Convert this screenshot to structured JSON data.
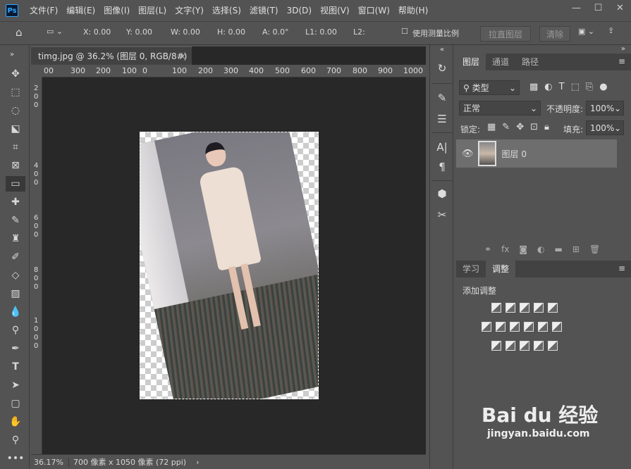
{
  "menubar": {
    "logo": "Ps",
    "items": [
      "文件(F)",
      "编辑(E)",
      "图像(I)",
      "图层(L)",
      "文字(Y)",
      "选择(S)",
      "滤镜(T)",
      "3D(D)",
      "视图(V)",
      "窗口(W)",
      "帮助(H)"
    ],
    "window_controls": [
      "minimize",
      "maximize",
      "close"
    ]
  },
  "options": {
    "x": "X: 0.00",
    "y": "Y: 0.00",
    "w": "W:  0.00",
    "h": "H:  0.00",
    "a": "A:  0.0°",
    "l1": "L1:  0.00",
    "l2": "L2:",
    "use_scale": "使用测量比例",
    "straighten": "拉直图层",
    "clear": "清除"
  },
  "tools": [
    "move-tool",
    "marquee-tool",
    "lasso-tool",
    "object-select-tool",
    "crop-tool",
    "frame-tool",
    "ruler-tool",
    "healing-tool",
    "brush-tool",
    "stamp-tool",
    "history-brush-tool",
    "eraser-tool",
    "gradient-tool",
    "blur-tool",
    "dodge-tool",
    "pen-tool",
    "type-tool",
    "path-select-tool",
    "shape-tool",
    "hand-tool",
    "zoom-tool",
    "more-tool"
  ],
  "document": {
    "tab_title": "timg.jpg @ 36.2% (图层 0, RGB/8#) *",
    "ruler_h": [
      "00",
      "300",
      "200",
      "100",
      "0",
      "100",
      "200",
      "300",
      "400",
      "500",
      "600",
      "700",
      "800",
      "900",
      "1000"
    ],
    "ruler_v": [
      "2",
      "0",
      "0",
      "4",
      "0",
      "0",
      "6",
      "0",
      "0",
      "8",
      "0",
      "0",
      "1",
      "0",
      "0",
      "0"
    ],
    "status_zoom": "36.17%",
    "status_info": "700 像素 x 1050 像素 (72 ppi)"
  },
  "layers_panel": {
    "tabs": [
      "图层",
      "通道",
      "路径"
    ],
    "filter": "类型",
    "blend": "正常",
    "opacity_label": "不透明度:",
    "opacity": "100%",
    "lock_label": "锁定:",
    "fill_label": "填充:",
    "fill": "100%",
    "layer_name": "图层 0"
  },
  "adjust_panel": {
    "tabs": [
      "学习",
      "调整"
    ],
    "title": "添加调整"
  },
  "watermark": {
    "brand": "Bai du 经验",
    "url": "jingyan.baidu.com"
  }
}
